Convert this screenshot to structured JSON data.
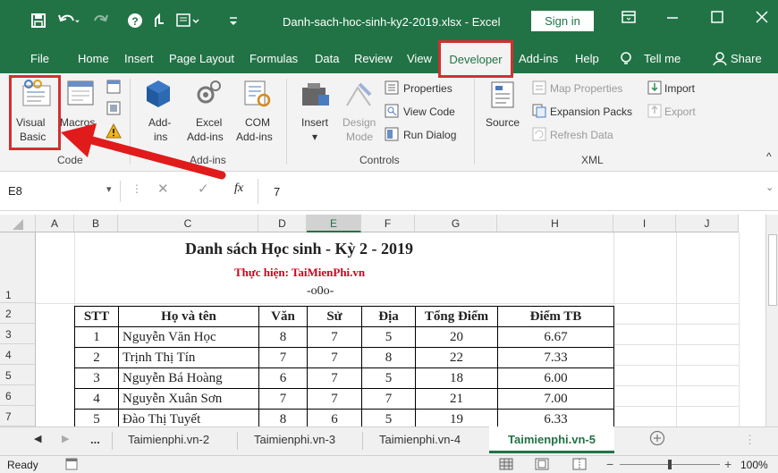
{
  "window": {
    "title": "Danh-sach-hoc-sinh-ky2-2019.xlsx  -  Excel",
    "sign_in": "Sign in"
  },
  "tabs": [
    {
      "label": "File"
    },
    {
      "label": "Home"
    },
    {
      "label": "Insert"
    },
    {
      "label": "Page Layout"
    },
    {
      "label": "Formulas"
    },
    {
      "label": "Data"
    },
    {
      "label": "Review"
    },
    {
      "label": "View"
    },
    {
      "label": "Developer"
    },
    {
      "label": "Add-ins"
    },
    {
      "label": "Help"
    },
    {
      "label": "Tell me"
    },
    {
      "label": "Share"
    }
  ],
  "ribbon": {
    "code": {
      "visual_basic_1": "Visual",
      "visual_basic_2": "Basic",
      "macros": "Macros",
      "group": "Code"
    },
    "addins": {
      "addins_1": "Add-",
      "addins_2": "ins",
      "excel_addins_1": "Excel",
      "excel_addins_2": "Add-ins",
      "com_addins_1": "COM",
      "com_addins_2": "Add-ins",
      "group": "Add-ins"
    },
    "controls": {
      "insert": "Insert",
      "design_mode_1": "Design",
      "design_mode_2": "Mode",
      "properties": "Properties",
      "view_code": "View Code",
      "run_dialog": "Run Dialog",
      "group": "Controls"
    },
    "xml": {
      "source": "Source",
      "map_properties": "Map Properties",
      "expansion_packs": "Expansion Packs",
      "refresh_data": "Refresh Data",
      "import": "Import",
      "export": "Export",
      "group": "XML"
    }
  },
  "formula_bar": {
    "name_box": "E8",
    "fx": "fx",
    "value": "7"
  },
  "columns": [
    "A",
    "B",
    "C",
    "D",
    "E",
    "F",
    "G",
    "H",
    "I",
    "J"
  ],
  "rows": [
    "1",
    "2",
    "3",
    "4",
    "5",
    "6",
    "7"
  ],
  "sheet": {
    "title": "Danh sách Học sinh - Kỳ 2 - 2019",
    "subtitle": "Thực hiện: TaiMienPhi.vn",
    "separator": "-o0o-",
    "headers": [
      "STT",
      "Họ và tên",
      "Văn",
      "Sử",
      "Địa",
      "Tổng Điểm",
      "Điểm TB"
    ],
    "data": [
      [
        "1",
        "Nguyễn Văn Học",
        "8",
        "7",
        "5",
        "20",
        "6.67"
      ],
      [
        "2",
        "Trịnh Thị Tín",
        "7",
        "7",
        "8",
        "22",
        "7.33"
      ],
      [
        "3",
        "Nguyễn Bá Hoàng",
        "6",
        "7",
        "5",
        "18",
        "6.00"
      ],
      [
        "4",
        "Nguyễn Xuân Sơn",
        "7",
        "7",
        "7",
        "21",
        "7.00"
      ],
      [
        "5",
        "Đào Thị Tuyết",
        "8",
        "6",
        "5",
        "19",
        "6.33"
      ]
    ]
  },
  "sheet_tabs": {
    "more": "...",
    "tabs": [
      "Taimienphi.vn-2",
      "Taimienphi.vn-3",
      "Taimienphi.vn-4"
    ],
    "active": "Taimienphi.vn-5"
  },
  "status": {
    "ready": "Ready",
    "zoom": "100%"
  },
  "colors": {
    "accent": "#217346",
    "highlight": "#d32f2f"
  }
}
